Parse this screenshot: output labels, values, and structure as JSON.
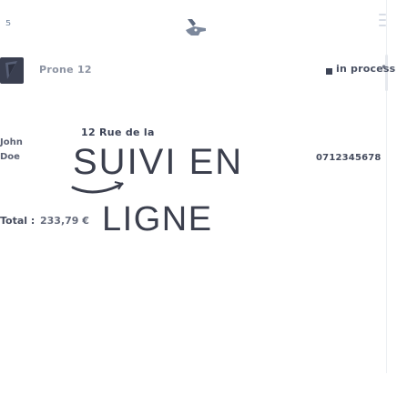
{
  "header": {
    "back_icon": "back-arrow-icon",
    "logo": "brand-logo-icon",
    "menu_icon": "menu-icon"
  },
  "order": {
    "user_name": "Prone 12",
    "status": "in process",
    "status_more": "•",
    "address": "12 Rue de la",
    "phone": "0712345678",
    "total_label": "Total :",
    "total_value": "233,79 €"
  },
  "side_labels": [
    "John",
    "Doe"
  ],
  "brand": {
    "line_1": "SUIVI EN",
    "line_2": "LIGNE"
  },
  "colors": {
    "text_dark": "#3b3f4d",
    "text_muted": "#8c93a2",
    "accent": "#6b7f99"
  }
}
